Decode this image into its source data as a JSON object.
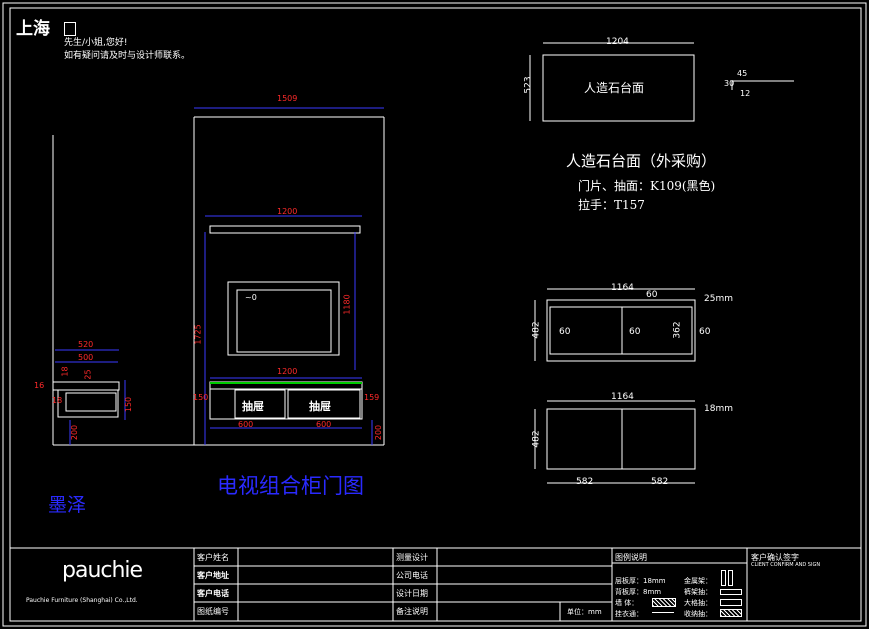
{
  "header": {
    "city": "上海",
    "greeting": "先生/小姐,您好!",
    "contact_note": "如有疑问请及时与设计师联系。"
  },
  "countertop": {
    "width_dim": "1204",
    "height_dim": "523",
    "label": "人造石台面",
    "detail_dims": [
      "45",
      "30",
      "12"
    ]
  },
  "spec": {
    "title": "人造石台面（外采购）",
    "line1": "门片、抽面：K109(黑色)",
    "line2": "拉手：T157"
  },
  "elevation": {
    "overall_width": "1509",
    "shelf_width": "1200",
    "height_1725": "1725",
    "height_1180": "1180",
    "base_width": "1200",
    "drawer_label_left": "抽屉",
    "drawer_label_right": "抽屉",
    "drawer_width_left": "600",
    "drawer_width_right": "600",
    "dim_150": "150",
    "dim_159": "159",
    "dim_200": "200",
    "tv_mark": "~0"
  },
  "side": {
    "dim_520": "520",
    "dim_500": "500",
    "dim_18": "18",
    "dim_25": "25",
    "dim_16": "16",
    "dim_150": "150",
    "dim_200": "200",
    "dim_18b": "18"
  },
  "plan_top": {
    "width": "1164",
    "dim_60_top": "60",
    "thick": "25mm",
    "height": "482",
    "inner_h": "362",
    "dim_60_a": "60",
    "dim_60_b": "60",
    "dim_60_c": "60"
  },
  "plan_bottom": {
    "width": "1164",
    "thick": "18mm",
    "height": "482",
    "left": "582",
    "right": "582"
  },
  "title": "电视组合柜门图",
  "signature": "墨泽",
  "footer": {
    "brand": "pauchie",
    "company": "Pauchie Furniture (Shanghai) Co.,Ltd.",
    "col1": [
      "客户姓名",
      "客户地址",
      "客户电话",
      "图纸编号"
    ],
    "col2": [
      "测量设计",
      "公司电话",
      "设计日期",
      "备注说明"
    ],
    "unit_label": "单位：mm",
    "legend_title": "图例说明",
    "legend_items": [
      "层板厚：18mm",
      "背板厚：8mm",
      "墙 体：",
      "挂衣通："
    ],
    "legend_items2": [
      "金属架：",
      "裤架抽：",
      "大格抽：",
      "收纳抽："
    ],
    "confirm_cn": "客户确认签字",
    "confirm_en": "CLIENT CONFIRM AND SIGN"
  },
  "colors": {
    "line": "#ffffff",
    "dim": "#ff2a2a",
    "accent": "#2a2aff",
    "background": "#000000"
  }
}
